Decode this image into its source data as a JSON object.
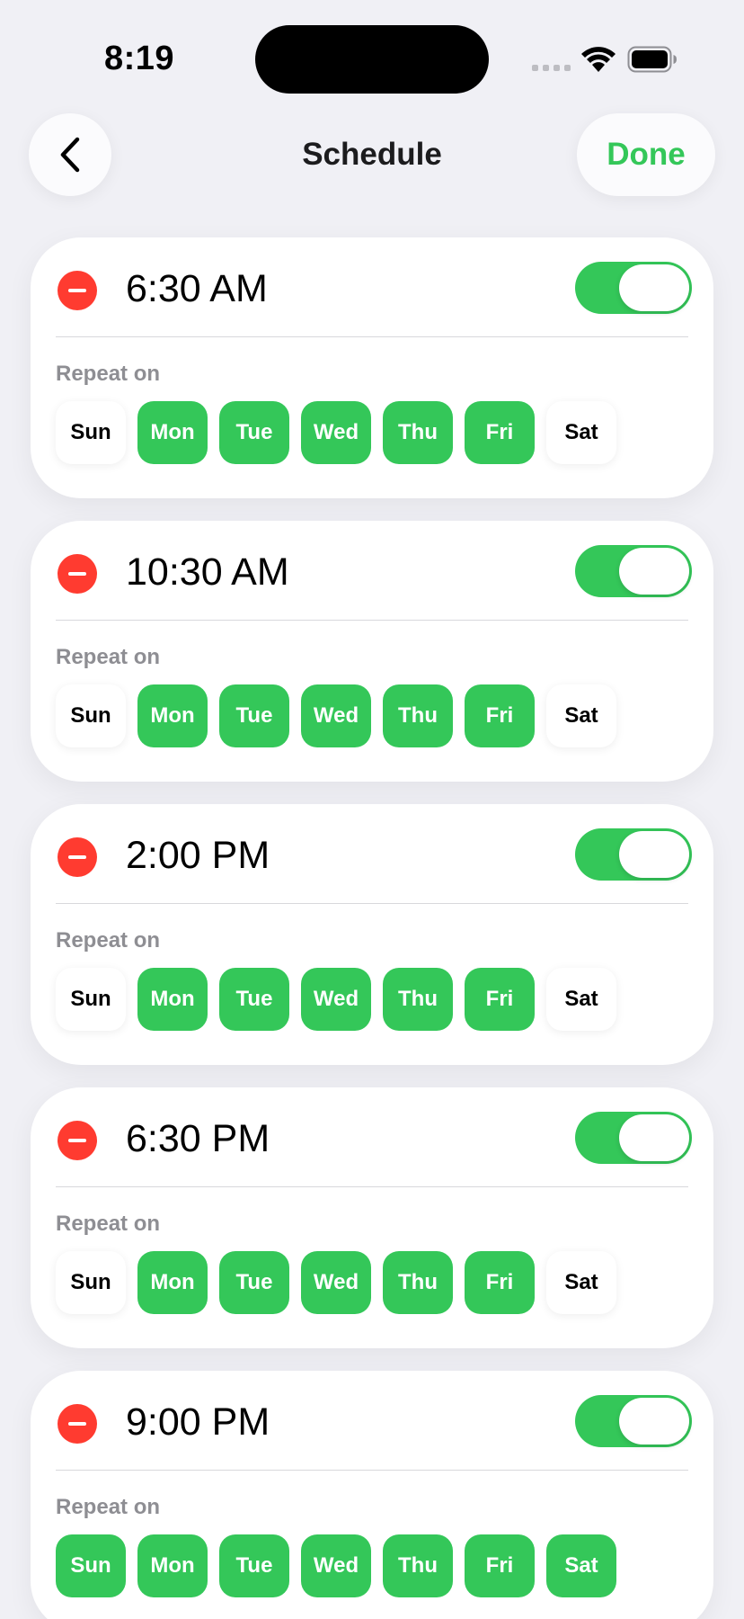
{
  "status_bar": {
    "time": "8:19"
  },
  "nav": {
    "title": "Schedule",
    "done_label": "Done"
  },
  "colors": {
    "accent": "#34c759",
    "destructive": "#ff3b30",
    "background": "#f0f0f5"
  },
  "repeat_label": "Repeat on",
  "schedules": [
    {
      "time": "6:30 AM",
      "enabled": true,
      "days": [
        {
          "label": "Sun",
          "on": false
        },
        {
          "label": "Mon",
          "on": true
        },
        {
          "label": "Tue",
          "on": true
        },
        {
          "label": "Wed",
          "on": true
        },
        {
          "label": "Thu",
          "on": true
        },
        {
          "label": "Fri",
          "on": true
        },
        {
          "label": "Sat",
          "on": false
        }
      ]
    },
    {
      "time": "10:30 AM",
      "enabled": true,
      "days": [
        {
          "label": "Sun",
          "on": false
        },
        {
          "label": "Mon",
          "on": true
        },
        {
          "label": "Tue",
          "on": true
        },
        {
          "label": "Wed",
          "on": true
        },
        {
          "label": "Thu",
          "on": true
        },
        {
          "label": "Fri",
          "on": true
        },
        {
          "label": "Sat",
          "on": false
        }
      ]
    },
    {
      "time": "2:00 PM",
      "enabled": true,
      "days": [
        {
          "label": "Sun",
          "on": false
        },
        {
          "label": "Mon",
          "on": true
        },
        {
          "label": "Tue",
          "on": true
        },
        {
          "label": "Wed",
          "on": true
        },
        {
          "label": "Thu",
          "on": true
        },
        {
          "label": "Fri",
          "on": true
        },
        {
          "label": "Sat",
          "on": false
        }
      ]
    },
    {
      "time": "6:30 PM",
      "enabled": true,
      "days": [
        {
          "label": "Sun",
          "on": false
        },
        {
          "label": "Mon",
          "on": true
        },
        {
          "label": "Tue",
          "on": true
        },
        {
          "label": "Wed",
          "on": true
        },
        {
          "label": "Thu",
          "on": true
        },
        {
          "label": "Fri",
          "on": true
        },
        {
          "label": "Sat",
          "on": false
        }
      ]
    },
    {
      "time": "9:00 PM",
      "enabled": true,
      "days": [
        {
          "label": "Sun",
          "on": true
        },
        {
          "label": "Mon",
          "on": true
        },
        {
          "label": "Tue",
          "on": true
        },
        {
          "label": "Wed",
          "on": true
        },
        {
          "label": "Thu",
          "on": true
        },
        {
          "label": "Fri",
          "on": true
        },
        {
          "label": "Sat",
          "on": true
        }
      ]
    }
  ]
}
